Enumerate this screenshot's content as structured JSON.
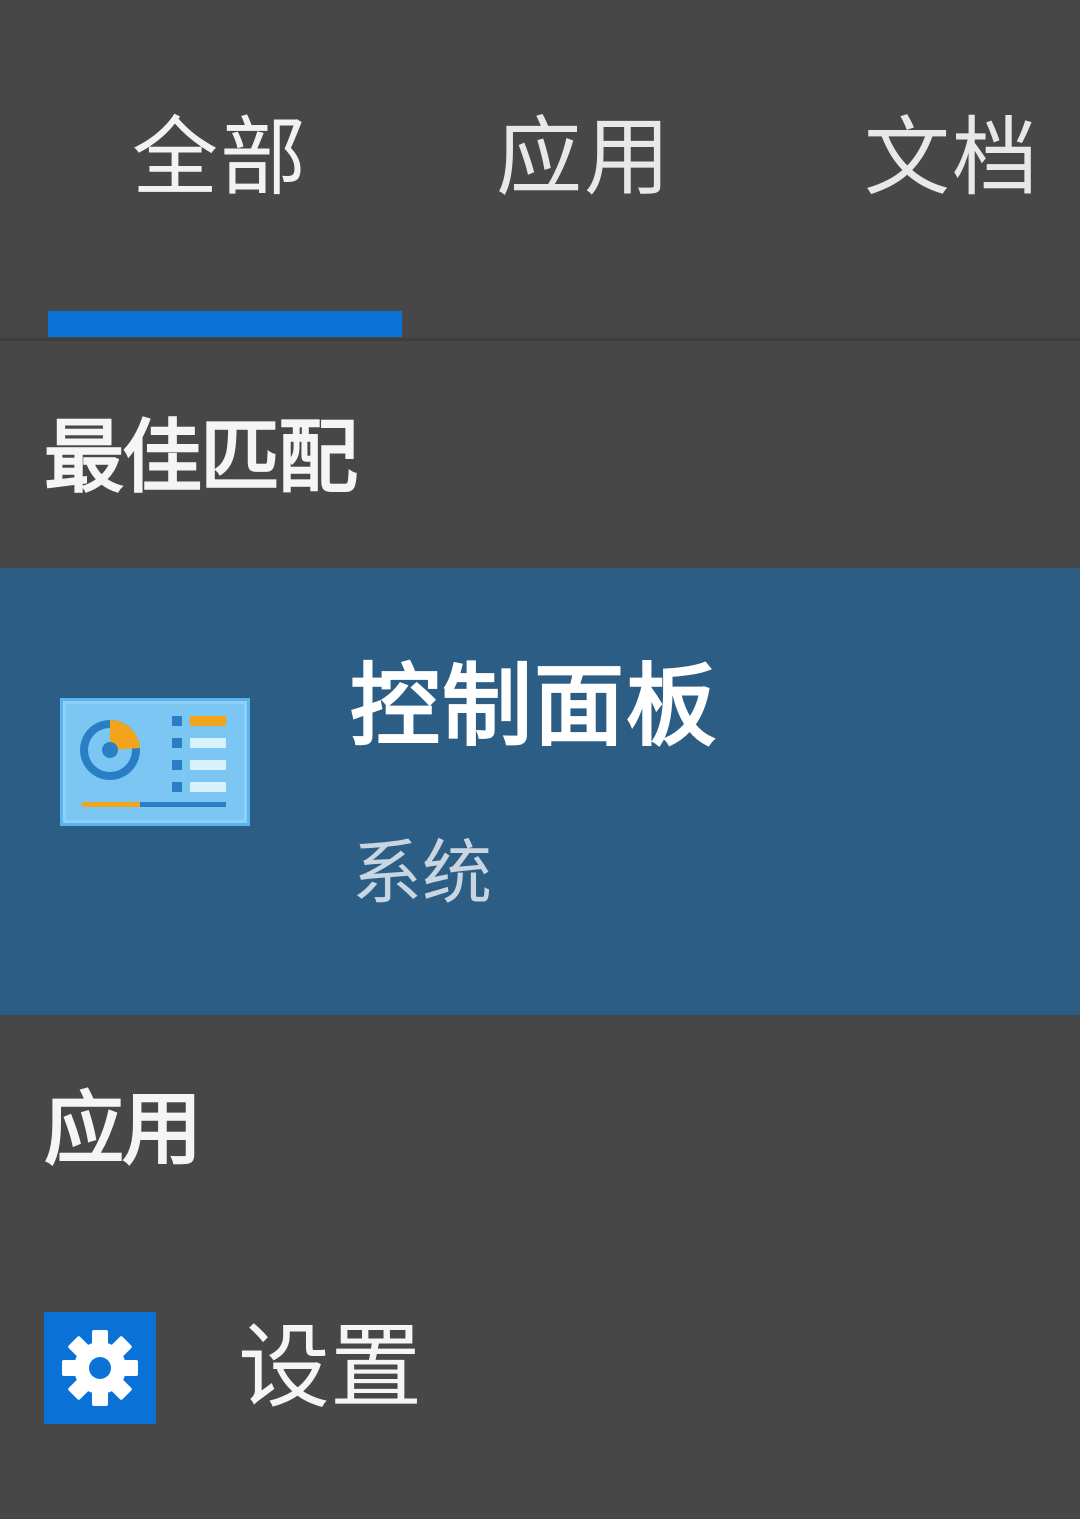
{
  "tabs": [
    {
      "label": "全部",
      "active": true
    },
    {
      "label": "应用",
      "active": false
    },
    {
      "label": "文档",
      "active": false
    }
  ],
  "sections": {
    "best_match": {
      "heading": "最佳匹配",
      "item": {
        "title": "控制面板",
        "subtitle": "系统",
        "icon": "control-panel-icon"
      }
    },
    "apps": {
      "heading": "应用",
      "items": [
        {
          "label": "设置",
          "icon": "gear-icon"
        }
      ]
    }
  },
  "colors": {
    "background": "#474747",
    "accent": "#0a72d6",
    "selected_row": "#2c5d84"
  }
}
